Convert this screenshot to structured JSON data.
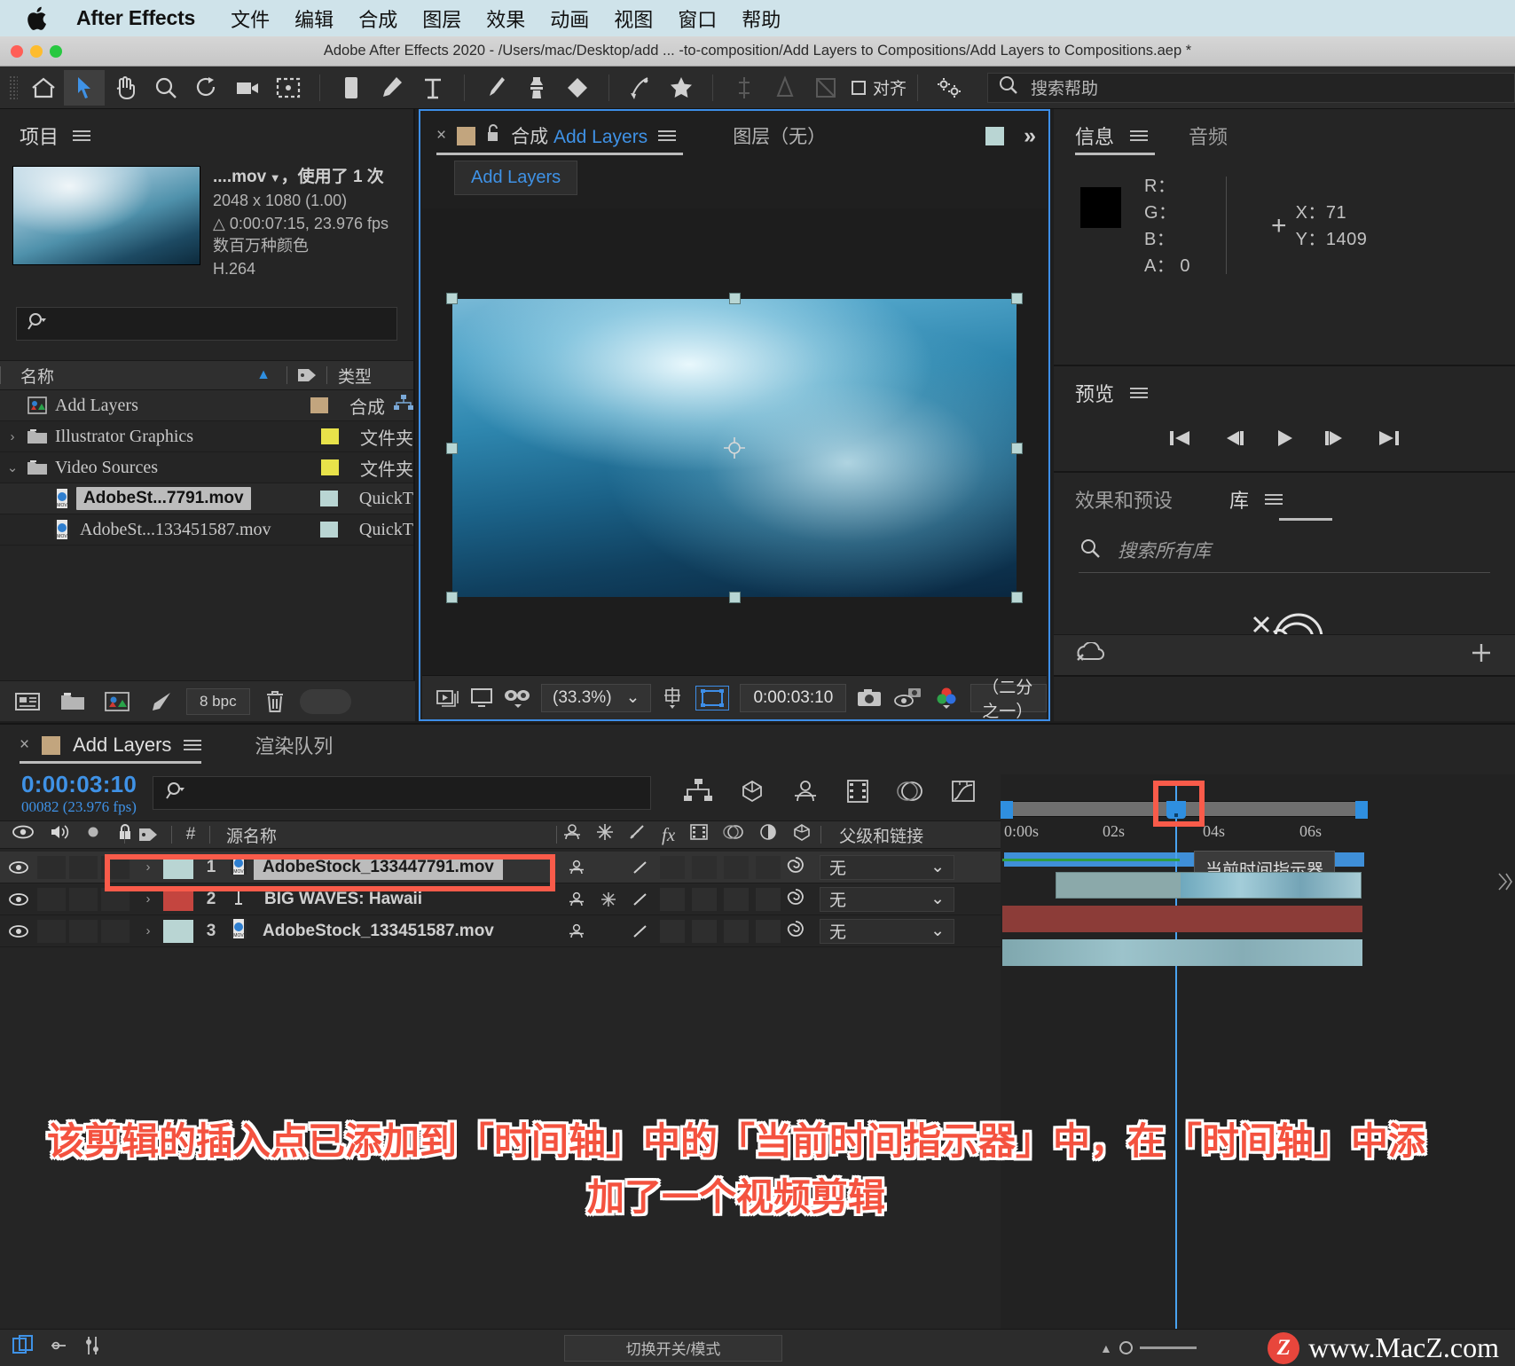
{
  "macmenu": {
    "app": "After Effects",
    "items": [
      "文件",
      "编辑",
      "合成",
      "图层",
      "效果",
      "动画",
      "视图",
      "窗口",
      "帮助"
    ]
  },
  "titlebar": {
    "title": "Adobe After Effects 2020 - /Users/mac/Desktop/add ... -to-composition/Add Layers to Compositions/Add Layers to Compositions.aep *"
  },
  "toolbar": {
    "align_label": "对齐",
    "search_placeholder": "搜索帮助"
  },
  "project": {
    "tab": "项目",
    "meta": {
      "name": "....mov",
      "usage": "，使用了 1 次",
      "size": "2048 x 1080 (1.00)",
      "duration": "△ 0:00:07:15, 23.976 fps",
      "colors": "数百万种颜色",
      "codec": "H.264"
    },
    "columns": {
      "name": "名称",
      "type": "类型"
    },
    "rows": [
      {
        "label": "Add Layers",
        "type": "合成",
        "swatch": "#c2a57e",
        "indent": 0,
        "twisty": "",
        "icon": "comp-icon",
        "selected": false
      },
      {
        "label": "Illustrator Graphics",
        "type": "文件夹",
        "swatch": "#e8e24a",
        "indent": 0,
        "twisty": "›",
        "icon": "folder-icon",
        "selected": false
      },
      {
        "label": "Video Sources",
        "type": "文件夹",
        "swatch": "#e8e24a",
        "indent": 0,
        "twisty": "⌄",
        "icon": "folder-icon",
        "selected": false
      },
      {
        "label": "AdobeSt...7791.mov",
        "type": "QuickT",
        "swatch": "#b9d5d3",
        "indent": 1,
        "twisty": "",
        "icon": "mov-icon",
        "selected": true
      },
      {
        "label": "AdobeSt...133451587.mov",
        "type": "QuickT",
        "swatch": "#b9d5d3",
        "indent": 1,
        "twisty": "",
        "icon": "mov-icon",
        "selected": false
      }
    ],
    "footer": {
      "bpc": "8 bpc"
    }
  },
  "composition": {
    "tab_prefix": "合成",
    "tab_name": "Add Layers",
    "tab_layer": "图层（无）",
    "chip": "Add Layers",
    "footer": {
      "zoom": "(33.3%)",
      "timecode": "0:00:03:10",
      "resolution": "（二分之一）"
    }
  },
  "info_panel": {
    "tab": "信息",
    "tab2": "音频",
    "r": "R：",
    "g": "G：",
    "b": "B：",
    "a": "A： 0",
    "x": "X：71",
    "y": "Y：1409"
  },
  "preview_panel": {
    "tab": "预览"
  },
  "library_panel": {
    "tab1": "效果和预设",
    "tab2": "库",
    "search_placeholder": "搜索所有库"
  },
  "timeline": {
    "tab_name": "Add Layers",
    "tab2": "渲染队列",
    "timecode": "0:00:03:10",
    "frames": "00082 (23.976 fps)",
    "columns": {
      "num": "#",
      "source_name": "源名称",
      "parent": "父级和链接"
    },
    "layers": [
      {
        "num": "1",
        "name": "AdobeStock_133447791.mov",
        "swatch": "#b9d5d3",
        "parent": "无",
        "selected": true,
        "type": "video"
      },
      {
        "num": "2",
        "name": "BIG WAVES: Hawaii",
        "swatch": "#c4453f",
        "parent": "无",
        "selected": false,
        "type": "text"
      },
      {
        "num": "3",
        "name": "AdobeStock_133451587.mov",
        "swatch": "#b9d5d3",
        "parent": "无",
        "selected": false,
        "type": "video"
      }
    ],
    "ruler_ticks": [
      "0:00s",
      "02s",
      "04s",
      "06s"
    ],
    "tooltip": "当前时间指示器"
  },
  "statusbar": {
    "toggle_label": "切换开关/模式",
    "brand_badge": "Z",
    "brand_text": "www.MacZ.com"
  },
  "annotation": "该剪辑的插入点已添加到「时间轴」中的「当前时间指示器」中，在「时间轴」中添加了一个视频剪辑"
}
